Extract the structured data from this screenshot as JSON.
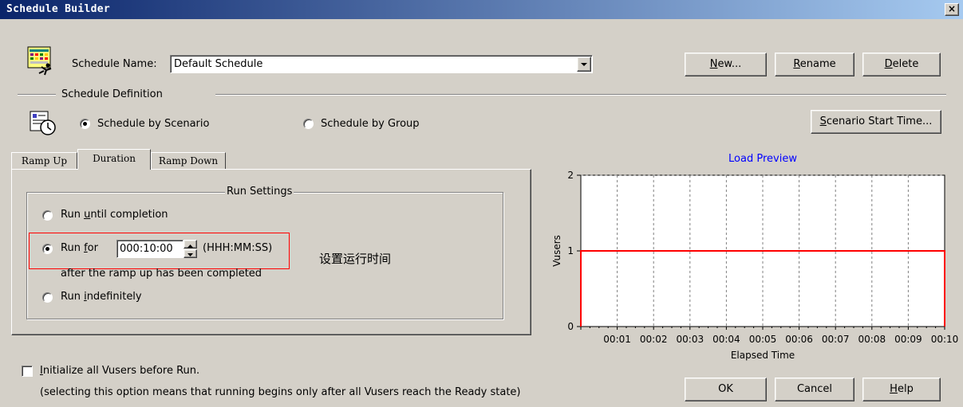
{
  "window": {
    "title": "Schedule Builder",
    "close_glyph": "×"
  },
  "schedule": {
    "name_label": "Schedule Name:",
    "name_value": "Default Schedule",
    "new_button": "New...",
    "rename_button": "Rename",
    "delete_button": "Delete"
  },
  "definition": {
    "section_label": "Schedule Definition",
    "by_scenario_label": "Schedule by Scenario",
    "by_scenario_checked": true,
    "by_group_label": "Schedule by Group",
    "scenario_start_button": "Scenario Start Time..."
  },
  "tabs": [
    {
      "label": "Ramp Up",
      "active": false
    },
    {
      "label": "Duration",
      "active": true
    },
    {
      "label": "Ramp Down",
      "active": false
    }
  ],
  "run_settings": {
    "group_label": "Run Settings",
    "run_until_completion": "Run until completion",
    "run_for_label": "Run for",
    "run_for_value": "000:10:00",
    "run_for_format": "(HHH:MM:SS)",
    "run_for_checked": true,
    "run_for_note": "after the ramp up has been completed",
    "run_indefinitely": "Run indefinitely",
    "annotation": "设置运行时间"
  },
  "chart_data": {
    "type": "line",
    "title": "Load Preview",
    "xlabel": "Elapsed Time",
    "ylabel": "Vusers",
    "ylim": [
      0,
      2
    ],
    "y_ticks": [
      "0",
      "1",
      "2"
    ],
    "x_ticks": [
      "00:01",
      "00:02",
      "00:03",
      "00:04",
      "00:05",
      "00:06",
      "00:07",
      "00:08",
      "00:09",
      "00:10"
    ],
    "grid": true,
    "series": [
      {
        "x_minutes": [
          0,
          0,
          10,
          10
        ],
        "values": [
          0,
          1,
          1,
          0
        ],
        "color": "#ff0000"
      }
    ],
    "title_color": "#0000ff"
  },
  "init_option": {
    "label": "Initialize all Vusers before Run.",
    "checked": false,
    "note": "(selecting this option means that running begins only after all Vusers reach the Ready state)"
  },
  "footer": {
    "ok_button": "OK",
    "cancel_button": "Cancel",
    "help_button": "Help"
  }
}
